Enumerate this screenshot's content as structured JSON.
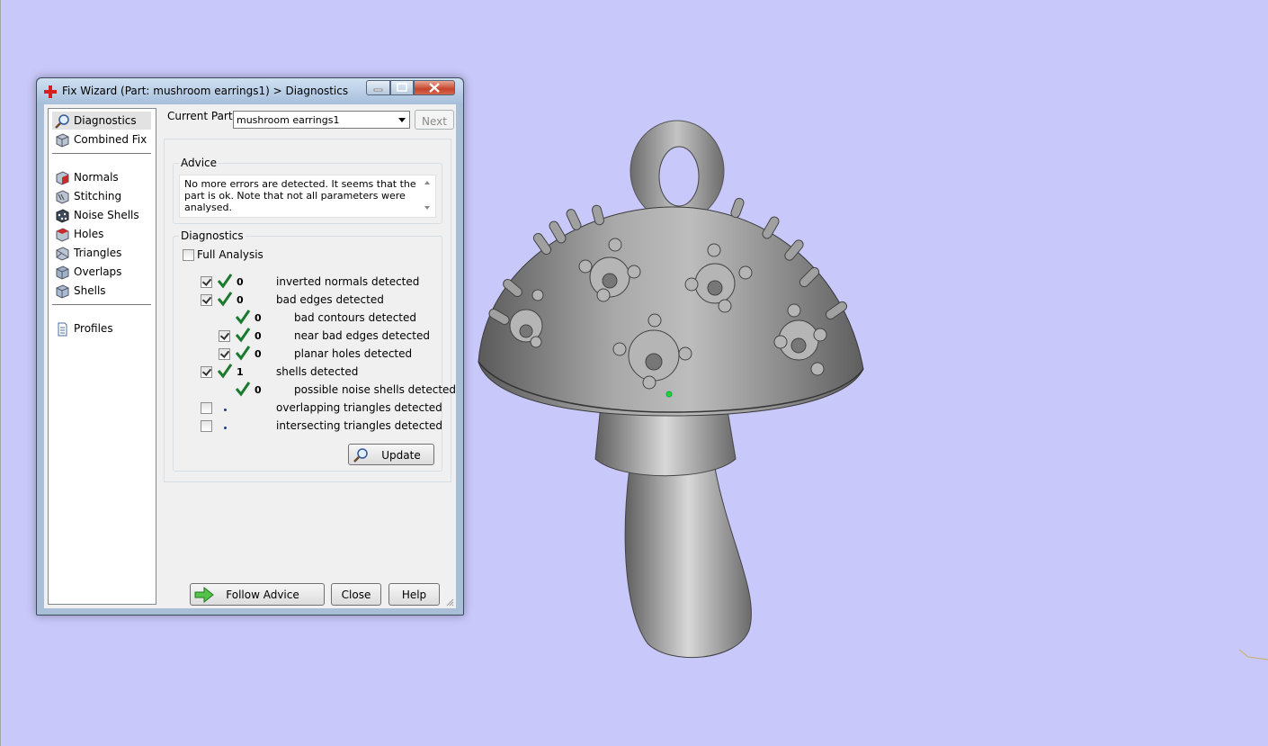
{
  "window": {
    "title": "Fix Wizard (Part: mushroom earrings1) > Diagnostics"
  },
  "nav": {
    "items": [
      {
        "label": "Diagnostics",
        "icon": "magnifier-icon"
      },
      {
        "label": "Combined Fix",
        "icon": "cube-icon"
      },
      {
        "label": "Normals",
        "icon": "normals-cube-icon"
      },
      {
        "label": "Stitching",
        "icon": "stitching-cube-icon"
      },
      {
        "label": "Noise Shells",
        "icon": "noise-shells-cube-icon"
      },
      {
        "label": "Holes",
        "icon": "holes-cube-icon"
      },
      {
        "label": "Triangles",
        "icon": "triangles-cube-icon"
      },
      {
        "label": "Overlaps",
        "icon": "overlaps-cube-icon"
      },
      {
        "label": "Shells",
        "icon": "shells-cube-icon"
      },
      {
        "label": "Profiles",
        "icon": "document-icon"
      }
    ],
    "selected": "Diagnostics"
  },
  "current_part": {
    "label": "Current Part:",
    "value": "mushroom earrings1",
    "next_label": "Next"
  },
  "advice": {
    "title": "Advice",
    "text": "No more errors are detected. It seems that the part is ok. Note that not all parameters were analysed."
  },
  "diagnostics": {
    "title": "Diagnostics",
    "full_analysis_label": "Full Analysis",
    "rows": [
      {
        "count": "0",
        "label": "inverted normals detected",
        "checked": true
      },
      {
        "count": "0",
        "label": "bad edges detected",
        "checked": true
      },
      {
        "count": "0",
        "label": "bad contours detected"
      },
      {
        "count": "0",
        "label": "near bad edges detected",
        "checked": true
      },
      {
        "count": "0",
        "label": "planar holes detected",
        "checked": true
      },
      {
        "count": "1",
        "label": "shells detected",
        "checked": true
      },
      {
        "count": "0",
        "label": "possible noise shells detected"
      },
      {
        "count": "",
        "label": "overlapping triangles detected",
        "checked": false
      },
      {
        "count": "",
        "label": "intersecting triangles detected",
        "checked": false
      }
    ],
    "update_label": "Update"
  },
  "footer": {
    "follow_advice_label": "Follow Advice",
    "close_label": "Close",
    "help_label": "Help"
  },
  "colors": {
    "viewport_bg": "#c8c8fa",
    "check_green": "#1a7a2e",
    "model_gray": "#8c8c8c"
  }
}
